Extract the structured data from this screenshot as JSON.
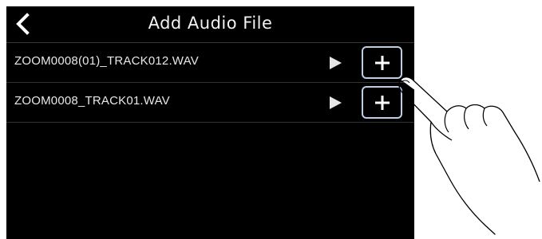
{
  "header": {
    "title": "Add Audio File",
    "back_icon": "chevron-left-icon"
  },
  "files": [
    {
      "name": "ZOOM0008(01)_TRACK012.WAV",
      "play_icon": "play-icon",
      "add_icon": "plus-icon"
    },
    {
      "name": "ZOOM0008_TRACK01.WAV",
      "play_icon": "play-icon",
      "add_icon": "plus-icon"
    }
  ],
  "colors": {
    "screen": "#000000",
    "text": "#f2f2f2",
    "highlight": "#c0cde6"
  }
}
